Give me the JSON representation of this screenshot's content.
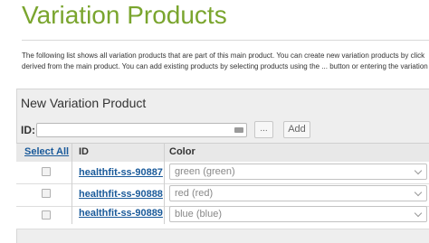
{
  "page": {
    "title": "Variation Products",
    "description_line1": "The following list shows all variation products that are part of this main product. You can create new variation products by click",
    "description_line2": "derived from the main product. You can add existing products by selecting products using the ... button or entering the variation"
  },
  "new_variation": {
    "heading": "New Variation Product",
    "id_label": "ID:",
    "id_value": "",
    "browse_label": "...",
    "add_label": "Add"
  },
  "table": {
    "headers": {
      "select_all": "Select All",
      "id": "ID",
      "color": "Color"
    },
    "rows": [
      {
        "id": "healthfit-ss-90887",
        "color": "green (green)"
      },
      {
        "id": "healthfit-ss-90888",
        "color": "red (red)"
      },
      {
        "id": "healthfit-ss-90889",
        "color": "blue (blue)"
      }
    ]
  },
  "colors": {
    "title_green": "#7aa52e",
    "link_blue": "#1a5a9a"
  }
}
